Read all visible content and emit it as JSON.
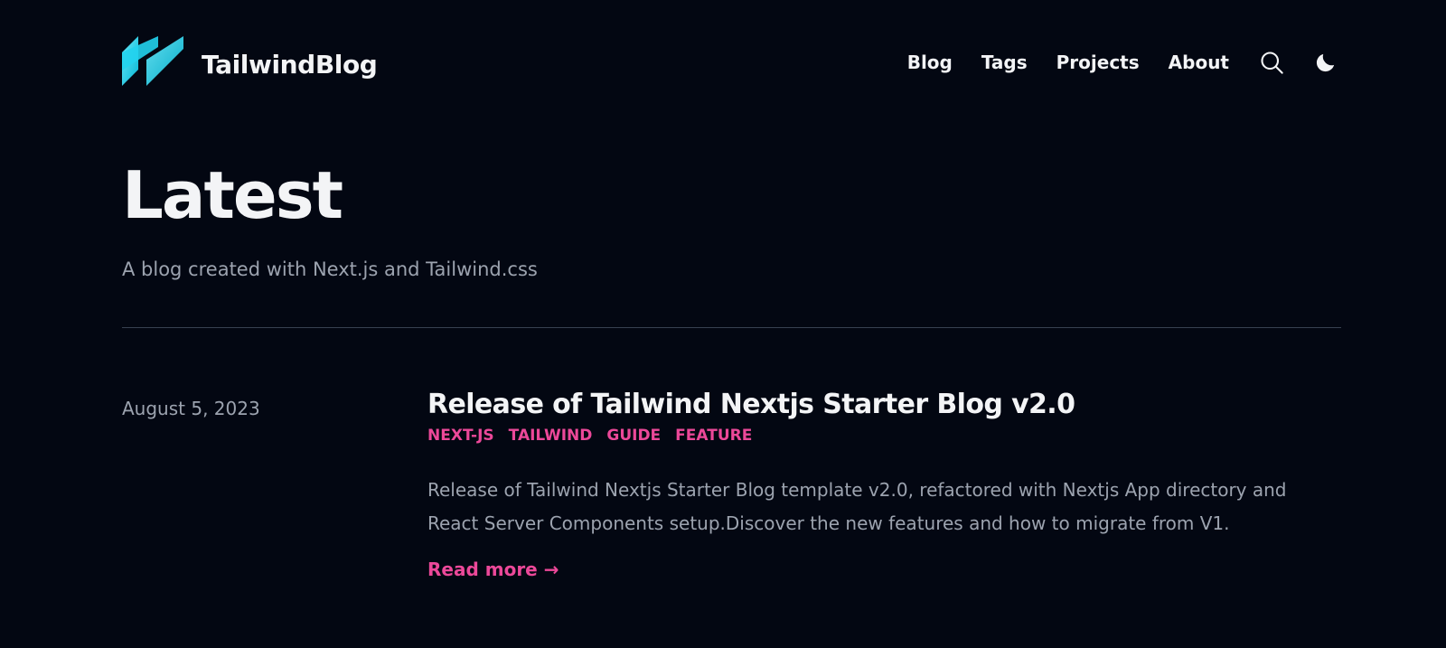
{
  "header": {
    "brand_name": "TailwindBlog",
    "nav": [
      {
        "label": "Blog"
      },
      {
        "label": "Tags"
      },
      {
        "label": "Projects"
      },
      {
        "label": "About"
      }
    ],
    "icons": {
      "logo": "tailwind-stripes-logo",
      "search": "search-icon",
      "theme": "moon-icon"
    }
  },
  "main": {
    "title": "Latest",
    "subtitle": "A blog created with Next.js and Tailwind.css"
  },
  "posts": [
    {
      "date": "August 5, 2023",
      "title": "Release of Tailwind Nextjs Starter Blog v2.0",
      "tags": [
        "NEXT-JS",
        "TAILWIND",
        "GUIDE",
        "FEATURE"
      ],
      "summary": "Release of Tailwind Nextjs Starter Blog template v2.0, refactored with Nextjs App directory and React Server Components setup.Discover the new features and how to migrate from V1.",
      "read_more": "Read more →"
    }
  ],
  "colors": {
    "background": "#030712",
    "text": "#f3f4f6",
    "muted": "#9ca3af",
    "accent": "#ec4899",
    "logo_light": "#67e8f9",
    "logo_dark": "#06b6d4"
  }
}
